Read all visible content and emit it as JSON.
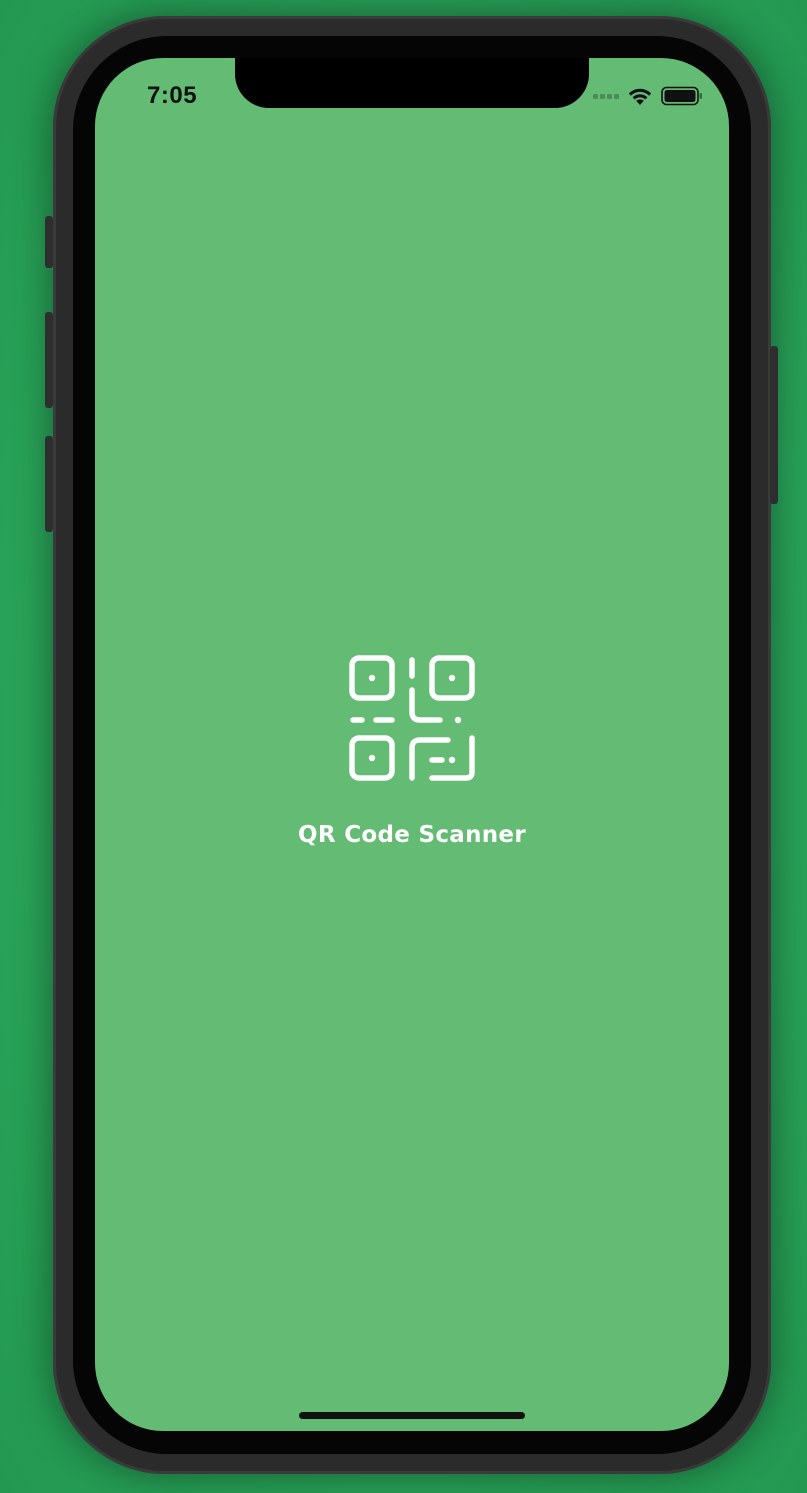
{
  "status_bar": {
    "time": "7:05",
    "signal_icon": "signal-bars-icon",
    "wifi_icon": "wifi-icon",
    "battery_icon": "battery-icon"
  },
  "splash": {
    "logo_icon": "qr-code-icon",
    "title": "QR Code Scanner"
  },
  "colors": {
    "screen_background": "#64bb74",
    "outer_background": "#2aa65b",
    "title_color": "#ffffff"
  }
}
